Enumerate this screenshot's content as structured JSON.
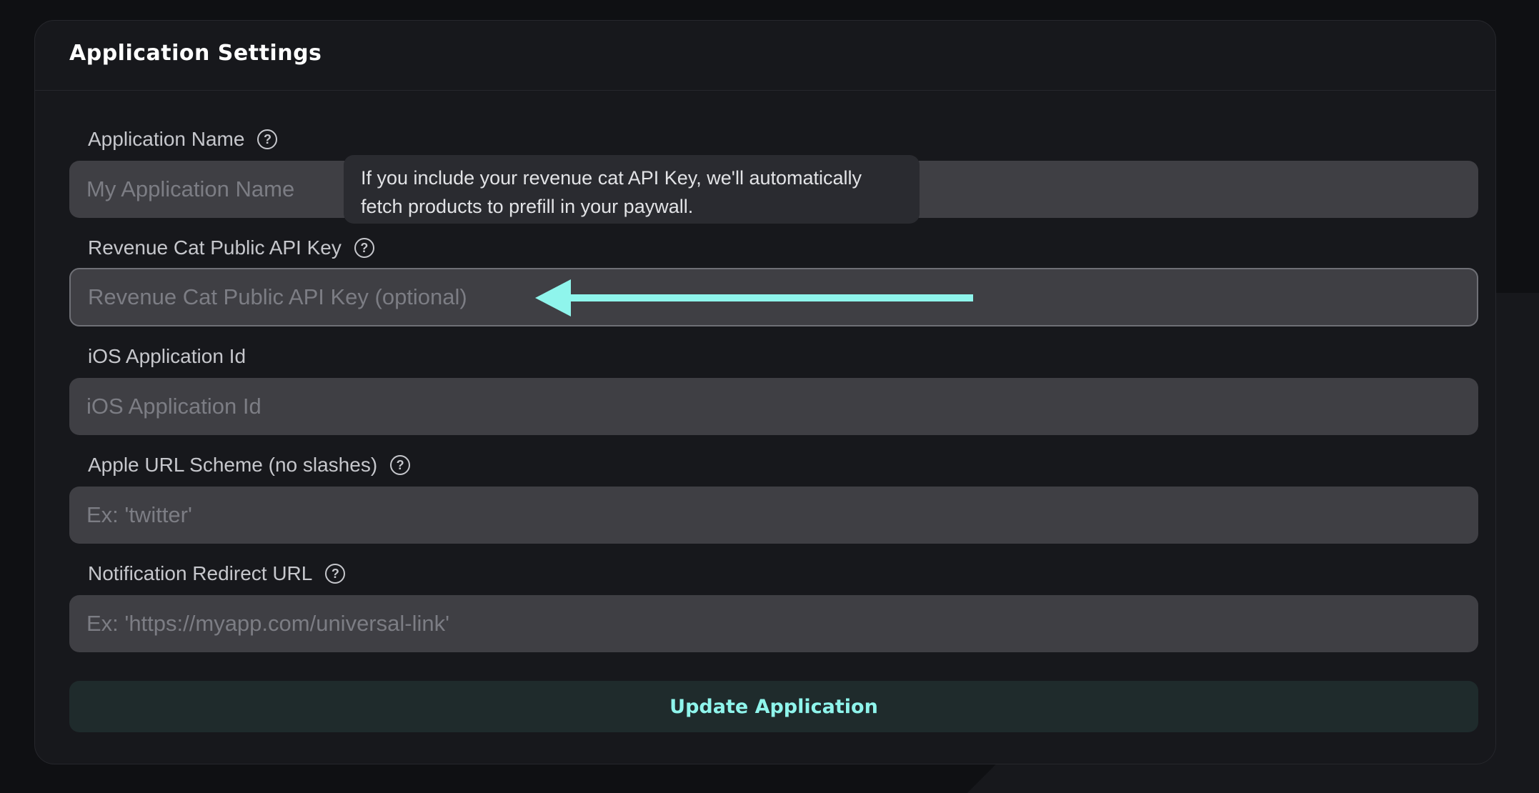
{
  "card": {
    "title": "Application Settings"
  },
  "fields": [
    {
      "label": "Application Name",
      "placeholder": "My Application Name",
      "has_help": true
    },
    {
      "label": "Revenue Cat Public API Key",
      "placeholder": "Revenue Cat Public API Key (optional)",
      "has_help": true
    },
    {
      "label": "iOS Application Id",
      "placeholder": "iOS Application Id",
      "has_help": false
    },
    {
      "label": "Apple URL Scheme (no slashes)",
      "placeholder": "Ex: 'twitter'",
      "has_help": true
    },
    {
      "label": "Notification Redirect URL",
      "placeholder": "Ex: 'https://myapp.com/universal-link'",
      "has_help": true
    }
  ],
  "tooltip": {
    "text_line1": "If you include your revenue cat API Key, we'll automatically",
    "text_line2": "fetch products to prefill in your paywall."
  },
  "help_icon": {
    "glyph": "?",
    "icon": "question-circle-icon"
  },
  "submit": {
    "label": "Update Application"
  },
  "colors": {
    "accent": "#8ff5ec",
    "background": "#0f1013",
    "card": "#17181c",
    "input": "#3f3f44"
  }
}
